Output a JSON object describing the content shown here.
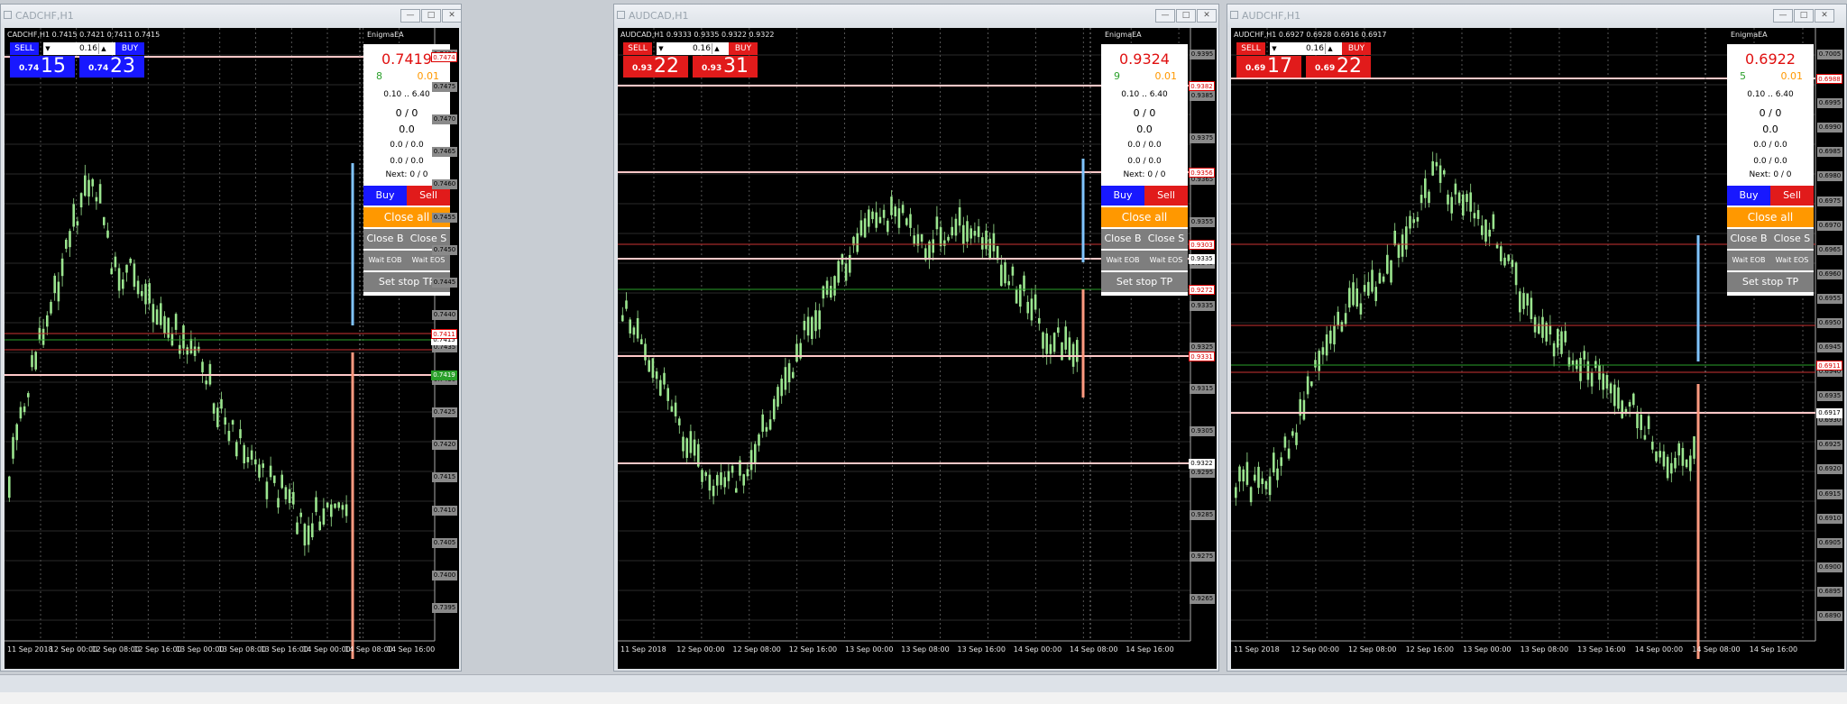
{
  "colors": {
    "blue_btn": "#1818ff",
    "red_btn": "#e11b1b",
    "close_all": "#ff9800",
    "candle": "#9be58f",
    "hline": "#ffc8c8",
    "vline_up": "#80c4ff",
    "vline_dn": "#ff9a80",
    "green_tag": "#2aa02a"
  },
  "windows": [
    {
      "title": "CADCHF,H1",
      "symbol_line": "CADCHF,H1  0.7415 0.7421 0.7411 0.7415",
      "ea": "EnigmaEA",
      "theme": "blue",
      "sell_label": "SELL",
      "buy_label": "BUY",
      "lot": "0.16",
      "sell_small": "0.74",
      "sell_big": "15",
      "buy_small": "0.74",
      "buy_big": "23",
      "panel": {
        "price": "0.7419",
        "spread": "8",
        "point": "0.01",
        "range": "0.10 .. 6.40",
        "r1": "0 / 0",
        "r2": "0.0",
        "r3": "0.0 / 0.0",
        "r4": "0.0 / 0.0",
        "next": "Next: 0 / 0",
        "buy": "Buy",
        "sell": "Sell",
        "close_all": "Close all",
        "close_b": "Close B",
        "close_s": "Close S",
        "wait_eob": "Wait EOB",
        "wait_eos": "Wait EOS",
        "stop_tp": "Set stop TP"
      },
      "y_axis": [
        "0.7480",
        "0.7475",
        "0.7470",
        "0.7465",
        "0.7460",
        "0.7455",
        "0.7450",
        "0.7445",
        "0.7440",
        "0.7435",
        "0.7430",
        "0.7425",
        "0.7420",
        "0.7415",
        "0.7410",
        "0.7405",
        "0.7400",
        "0.7395"
      ],
      "x_axis": [
        "11 Sep 2018",
        "12 Sep 00:00",
        "12 Sep 08:00",
        "12 Sep 16:00",
        "13 Sep 00:00",
        "13 Sep 08:00",
        "13 Sep 16:00",
        "14 Sep 00:00",
        "14 Sep 08:00",
        "14 Sep 16:00"
      ],
      "price_tags": [
        {
          "label": "0.7474",
          "kind": "red"
        },
        {
          "label": "0.7419",
          "kind": "green"
        },
        {
          "label": "0.7415",
          "kind": "white"
        },
        {
          "label": "0.7411",
          "kind": "red"
        }
      ]
    },
    {
      "title": "AUDCAD,H1",
      "symbol_line": "AUDCAD,H1  0.9333 0.9335 0.9322 0.9322",
      "ea": "EnigmaEA",
      "theme": "red",
      "sell_label": "SELL",
      "buy_label": "BUY",
      "lot": "0.16",
      "sell_small": "0.93",
      "sell_big": "22",
      "buy_small": "0.93",
      "buy_big": "31",
      "panel": {
        "price": "0.9324",
        "spread": "9",
        "point": "0.01",
        "range": "0.10 .. 6.40",
        "r1": "0 / 0",
        "r2": "0.0",
        "r3": "0.0 / 0.0",
        "r4": "0.0 / 0.0",
        "next": "Next: 0 / 0",
        "buy": "Buy",
        "sell": "Sell",
        "close_all": "Close all",
        "close_b": "Close B",
        "close_s": "Close S",
        "wait_eob": "Wait EOB",
        "wait_eos": "Wait EOS",
        "stop_tp": "Set stop TP"
      },
      "y_axis": [
        "0.9395",
        "0.9385",
        "0.9375",
        "0.9365",
        "0.9355",
        "0.9345",
        "0.9335",
        "0.9325",
        "0.9315",
        "0.9305",
        "0.9295",
        "0.9285",
        "0.9275",
        "0.9265"
      ],
      "x_axis": [
        "11 Sep 2018",
        "12 Sep 00:00",
        "12 Sep 08:00",
        "12 Sep 16:00",
        "13 Sep 00:00",
        "13 Sep 08:00",
        "13 Sep 16:00",
        "14 Sep 00:00",
        "14 Sep 08:00",
        "14 Sep 16:00"
      ],
      "price_tags": [
        {
          "label": "0.9382",
          "kind": "red"
        },
        {
          "label": "0.9356",
          "kind": "red"
        },
        {
          "label": "0.9335",
          "kind": "white"
        },
        {
          "label": "0.9331",
          "kind": "red"
        },
        {
          "label": "0.9322",
          "kind": "white"
        },
        {
          "label": "0.9303",
          "kind": "red"
        },
        {
          "label": "0.9272",
          "kind": "red"
        }
      ]
    },
    {
      "title": "AUDCHF,H1",
      "symbol_line": "AUDCHF,H1  0.6927 0.6928 0.6916 0.6917",
      "ea": "EnigmaEA",
      "theme": "red",
      "sell_label": "SELL",
      "buy_label": "BUY",
      "lot": "0.16",
      "sell_small": "0.69",
      "sell_big": "17",
      "buy_small": "0.69",
      "buy_big": "22",
      "panel": {
        "price": "0.6922",
        "spread": "5",
        "point": "0.01",
        "range": "0.10 .. 6.40",
        "r1": "0 / 0",
        "r2": "0.0",
        "r3": "0.0 / 0.0",
        "r4": "0.0 / 0.0",
        "next": "Next: 0 / 0",
        "buy": "Buy",
        "sell": "Sell",
        "close_all": "Close all",
        "close_b": "Close B",
        "close_s": "Close S",
        "wait_eob": "Wait EOB",
        "wait_eos": "Wait EOS",
        "stop_tp": "Set stop TP"
      },
      "y_axis": [
        "0.7005",
        "0.7000",
        "0.6995",
        "0.6990",
        "0.6985",
        "0.6980",
        "0.6975",
        "0.6970",
        "0.6965",
        "0.6960",
        "0.6955",
        "0.6950",
        "0.6945",
        "0.6940",
        "0.6935",
        "0.6930",
        "0.6925",
        "0.6920",
        "0.6915",
        "0.6910",
        "0.6905",
        "0.6900",
        "0.6895",
        "0.6890"
      ],
      "x_axis": [
        "11 Sep 2018",
        "12 Sep 00:00",
        "12 Sep 08:00",
        "12 Sep 16:00",
        "13 Sep 00:00",
        "13 Sep 08:00",
        "13 Sep 16:00",
        "14 Sep 00:00",
        "14 Sep 08:00",
        "14 Sep 16:00"
      ],
      "price_tags": [
        {
          "label": "0.6988",
          "kind": "red"
        },
        {
          "label": "0.6917",
          "kind": "white"
        },
        {
          "label": "0.6911",
          "kind": "red"
        }
      ]
    }
  ]
}
